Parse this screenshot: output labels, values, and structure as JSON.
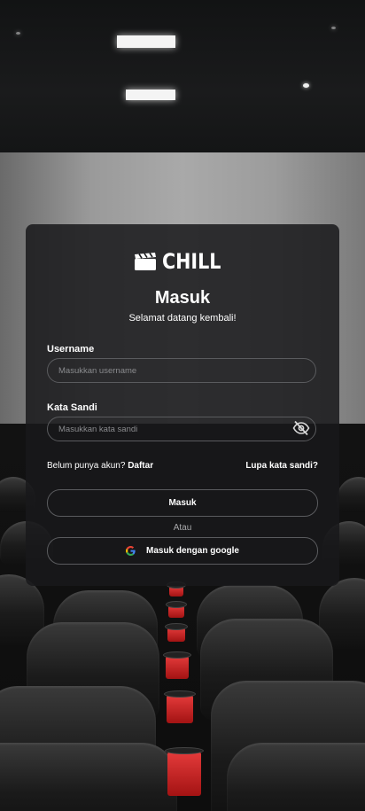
{
  "brand": {
    "name": "CHILL"
  },
  "login": {
    "title": "Masuk",
    "subtitle": "Selamat datang kembali!",
    "username_label": "Username",
    "username_placeholder": "Masukkan username",
    "password_label": "Kata Sandi",
    "password_placeholder": "Masukkan kata sandi",
    "no_account_text": "Belum punya akun?",
    "register_link": "Daftar",
    "forgot_password": "Lupa kata sandi?",
    "submit_label": "Masuk",
    "separator": "Atau",
    "google_label": "Masuk dengan google"
  },
  "icons": {
    "logo": "clapperboard-icon",
    "password_toggle": "eye-off-icon",
    "google": "google-icon"
  },
  "colors": {
    "card_background": "#18191B",
    "border": "#5A5B5E",
    "text": "#FFFFFF",
    "muted_text": "#A8A9AB"
  }
}
